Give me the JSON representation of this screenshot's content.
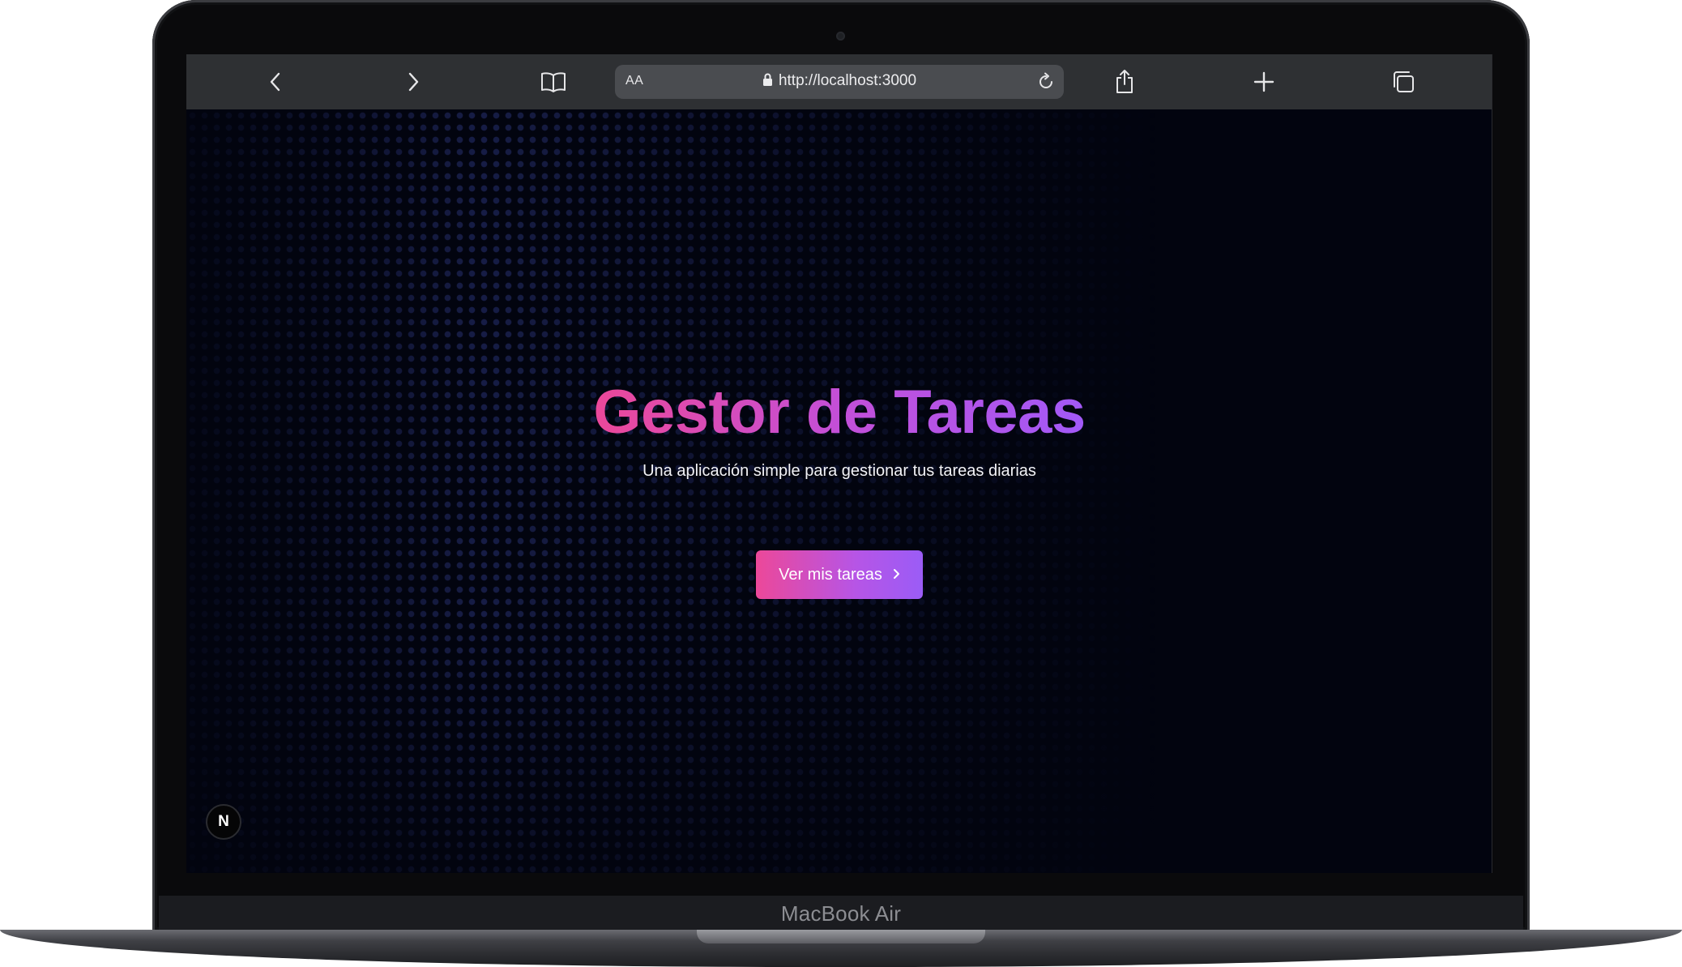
{
  "device": {
    "label": "MacBook Air"
  },
  "browser": {
    "address_bar": {
      "text_size_label": "AA",
      "url": "http://localhost:3000"
    },
    "icons": {
      "back": "chevron-left-icon",
      "forward": "chevron-right-icon",
      "bookmarks": "book-icon",
      "lock": "lock-icon",
      "reload": "reload-icon",
      "share": "share-icon",
      "new_tab": "plus-icon",
      "tabs": "tabs-overview-icon"
    }
  },
  "page": {
    "title": "Gestor de Tareas",
    "subtitle": "Una aplicación simple para gestionar tus tareas diarias",
    "cta": {
      "label": "Ver mis tareas",
      "icon": "chevron-right-icon"
    },
    "dev_badge": {
      "letter": "N"
    }
  },
  "colors": {
    "page_background": "#02040f",
    "gradient_start": "#ec4899",
    "gradient_end": "#9b5cf6",
    "toolbar_background": "#2e3033",
    "address_bar_background": "#4a4c50"
  }
}
